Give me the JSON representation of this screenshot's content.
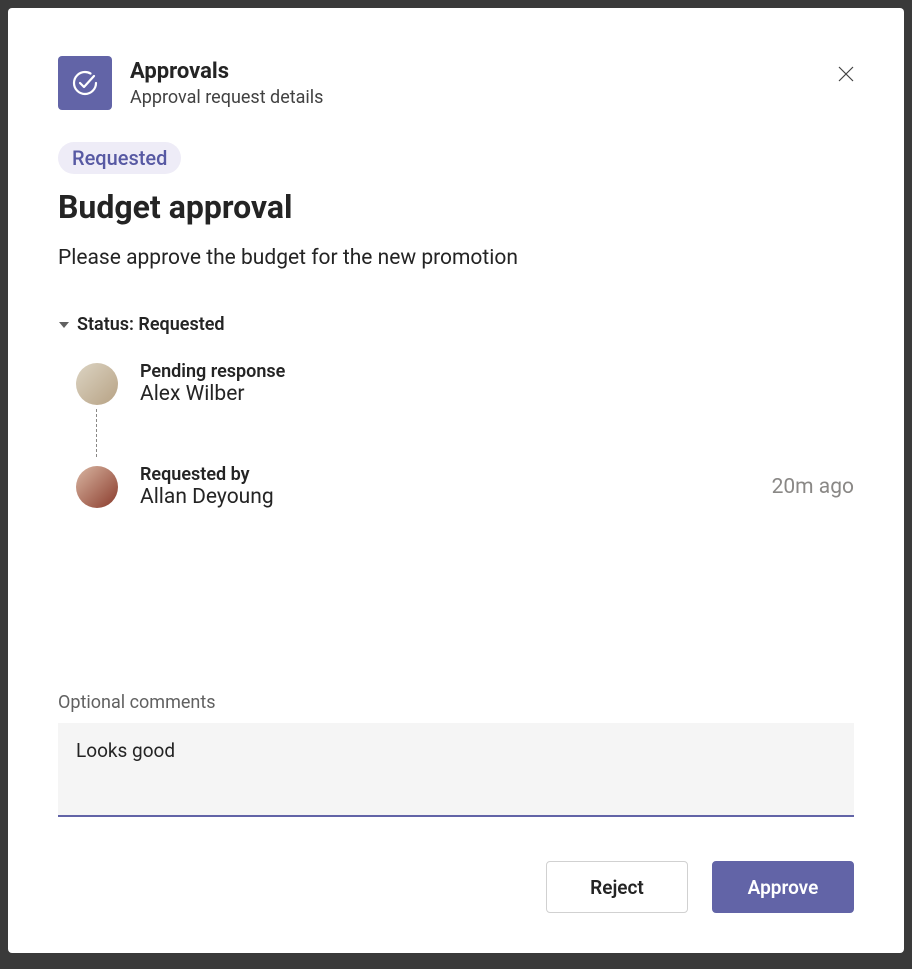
{
  "header": {
    "app_title": "Approvals",
    "app_subtitle": "Approval request details"
  },
  "status_badge": "Requested",
  "request": {
    "title": "Budget approval",
    "description": "Please approve the budget for the new promotion"
  },
  "status_section": {
    "label": "Status: Requested"
  },
  "approvers": [
    {
      "status_label": "Pending response",
      "name": "Alex Wilber"
    },
    {
      "status_label": "Requested by",
      "name": "Allan Deyoung",
      "time": "20m ago"
    }
  ],
  "comments": {
    "label": "Optional comments",
    "value": "Looks good"
  },
  "buttons": {
    "reject": "Reject",
    "approve": "Approve"
  }
}
